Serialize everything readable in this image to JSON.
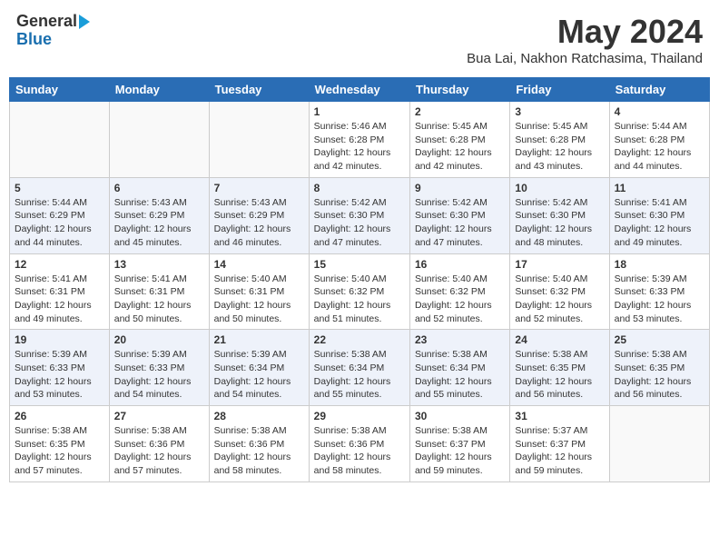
{
  "header": {
    "logo_general": "General",
    "logo_blue": "Blue",
    "month_title": "May 2024",
    "location": "Bua Lai, Nakhon Ratchasima, Thailand"
  },
  "weekdays": [
    "Sunday",
    "Monday",
    "Tuesday",
    "Wednesday",
    "Thursday",
    "Friday",
    "Saturday"
  ],
  "weeks": [
    [
      {
        "day": "",
        "info": ""
      },
      {
        "day": "",
        "info": ""
      },
      {
        "day": "",
        "info": ""
      },
      {
        "day": "1",
        "info": "Sunrise: 5:46 AM\nSunset: 6:28 PM\nDaylight: 12 hours\nand 42 minutes."
      },
      {
        "day": "2",
        "info": "Sunrise: 5:45 AM\nSunset: 6:28 PM\nDaylight: 12 hours\nand 42 minutes."
      },
      {
        "day": "3",
        "info": "Sunrise: 5:45 AM\nSunset: 6:28 PM\nDaylight: 12 hours\nand 43 minutes."
      },
      {
        "day": "4",
        "info": "Sunrise: 5:44 AM\nSunset: 6:28 PM\nDaylight: 12 hours\nand 44 minutes."
      }
    ],
    [
      {
        "day": "5",
        "info": "Sunrise: 5:44 AM\nSunset: 6:29 PM\nDaylight: 12 hours\nand 44 minutes."
      },
      {
        "day": "6",
        "info": "Sunrise: 5:43 AM\nSunset: 6:29 PM\nDaylight: 12 hours\nand 45 minutes."
      },
      {
        "day": "7",
        "info": "Sunrise: 5:43 AM\nSunset: 6:29 PM\nDaylight: 12 hours\nand 46 minutes."
      },
      {
        "day": "8",
        "info": "Sunrise: 5:42 AM\nSunset: 6:30 PM\nDaylight: 12 hours\nand 47 minutes."
      },
      {
        "day": "9",
        "info": "Sunrise: 5:42 AM\nSunset: 6:30 PM\nDaylight: 12 hours\nand 47 minutes."
      },
      {
        "day": "10",
        "info": "Sunrise: 5:42 AM\nSunset: 6:30 PM\nDaylight: 12 hours\nand 48 minutes."
      },
      {
        "day": "11",
        "info": "Sunrise: 5:41 AM\nSunset: 6:30 PM\nDaylight: 12 hours\nand 49 minutes."
      }
    ],
    [
      {
        "day": "12",
        "info": "Sunrise: 5:41 AM\nSunset: 6:31 PM\nDaylight: 12 hours\nand 49 minutes."
      },
      {
        "day": "13",
        "info": "Sunrise: 5:41 AM\nSunset: 6:31 PM\nDaylight: 12 hours\nand 50 minutes."
      },
      {
        "day": "14",
        "info": "Sunrise: 5:40 AM\nSunset: 6:31 PM\nDaylight: 12 hours\nand 50 minutes."
      },
      {
        "day": "15",
        "info": "Sunrise: 5:40 AM\nSunset: 6:32 PM\nDaylight: 12 hours\nand 51 minutes."
      },
      {
        "day": "16",
        "info": "Sunrise: 5:40 AM\nSunset: 6:32 PM\nDaylight: 12 hours\nand 52 minutes."
      },
      {
        "day": "17",
        "info": "Sunrise: 5:40 AM\nSunset: 6:32 PM\nDaylight: 12 hours\nand 52 minutes."
      },
      {
        "day": "18",
        "info": "Sunrise: 5:39 AM\nSunset: 6:33 PM\nDaylight: 12 hours\nand 53 minutes."
      }
    ],
    [
      {
        "day": "19",
        "info": "Sunrise: 5:39 AM\nSunset: 6:33 PM\nDaylight: 12 hours\nand 53 minutes."
      },
      {
        "day": "20",
        "info": "Sunrise: 5:39 AM\nSunset: 6:33 PM\nDaylight: 12 hours\nand 54 minutes."
      },
      {
        "day": "21",
        "info": "Sunrise: 5:39 AM\nSunset: 6:34 PM\nDaylight: 12 hours\nand 54 minutes."
      },
      {
        "day": "22",
        "info": "Sunrise: 5:38 AM\nSunset: 6:34 PM\nDaylight: 12 hours\nand 55 minutes."
      },
      {
        "day": "23",
        "info": "Sunrise: 5:38 AM\nSunset: 6:34 PM\nDaylight: 12 hours\nand 55 minutes."
      },
      {
        "day": "24",
        "info": "Sunrise: 5:38 AM\nSunset: 6:35 PM\nDaylight: 12 hours\nand 56 minutes."
      },
      {
        "day": "25",
        "info": "Sunrise: 5:38 AM\nSunset: 6:35 PM\nDaylight: 12 hours\nand 56 minutes."
      }
    ],
    [
      {
        "day": "26",
        "info": "Sunrise: 5:38 AM\nSunset: 6:35 PM\nDaylight: 12 hours\nand 57 minutes."
      },
      {
        "day": "27",
        "info": "Sunrise: 5:38 AM\nSunset: 6:36 PM\nDaylight: 12 hours\nand 57 minutes."
      },
      {
        "day": "28",
        "info": "Sunrise: 5:38 AM\nSunset: 6:36 PM\nDaylight: 12 hours\nand 58 minutes."
      },
      {
        "day": "29",
        "info": "Sunrise: 5:38 AM\nSunset: 6:36 PM\nDaylight: 12 hours\nand 58 minutes."
      },
      {
        "day": "30",
        "info": "Sunrise: 5:38 AM\nSunset: 6:37 PM\nDaylight: 12 hours\nand 59 minutes."
      },
      {
        "day": "31",
        "info": "Sunrise: 5:37 AM\nSunset: 6:37 PM\nDaylight: 12 hours\nand 59 minutes."
      },
      {
        "day": "",
        "info": ""
      }
    ]
  ]
}
